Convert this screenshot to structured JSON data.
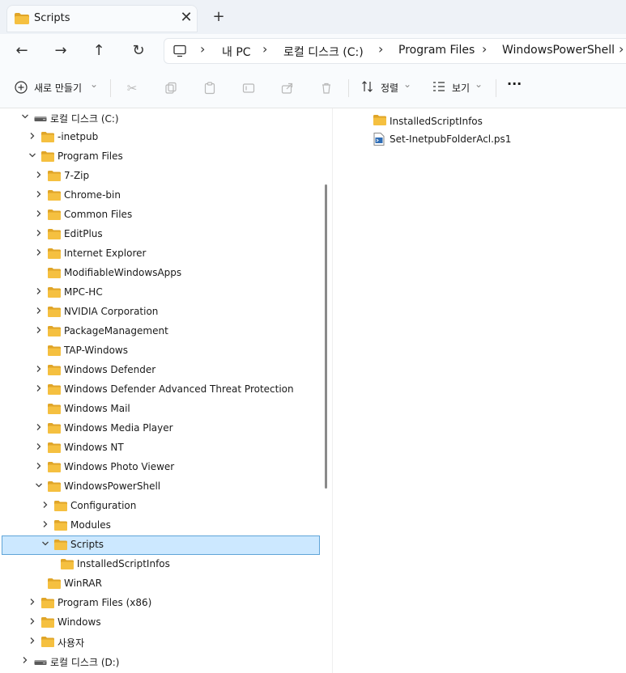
{
  "tab": {
    "title": "Scripts",
    "close": "✕",
    "new": "+"
  },
  "nav": {
    "back": "←",
    "forward": "→",
    "up": "↑",
    "refresh": "↻",
    "breadcrumb": [
      "내 PC",
      "로컬 디스크 (C:)",
      "Program Files",
      "WindowsPowerShell"
    ],
    "sep": "›"
  },
  "toolbar": {
    "new_label": "새로 만들기",
    "sort_label": "정렬",
    "view_label": "보기",
    "more": "···",
    "chevron": "⌄"
  },
  "tree": [
    {
      "label": "로컬 디스크 (C:)",
      "type": "drive",
      "chev": "down"
    },
    {
      "label": "-inetpub",
      "type": "folder",
      "chev": "right"
    },
    {
      "label": "Program Files",
      "type": "folder",
      "chev": "down"
    },
    {
      "label": "7-Zip",
      "type": "folder",
      "chev": "right"
    },
    {
      "label": "Chrome-bin",
      "type": "folder",
      "chev": "right"
    },
    {
      "label": "Common Files",
      "type": "folder",
      "chev": "right"
    },
    {
      "label": "EditPlus",
      "type": "folder",
      "chev": "right"
    },
    {
      "label": "Internet Explorer",
      "type": "folder",
      "chev": "right"
    },
    {
      "label": "ModifiableWindowsApps",
      "type": "folder",
      "chev": ""
    },
    {
      "label": "MPC-HC",
      "type": "folder",
      "chev": "right"
    },
    {
      "label": "NVIDIA Corporation",
      "type": "folder",
      "chev": "right"
    },
    {
      "label": "PackageManagement",
      "type": "folder",
      "chev": "right"
    },
    {
      "label": "TAP-Windows",
      "type": "folder",
      "chev": ""
    },
    {
      "label": "Windows Defender",
      "type": "folder",
      "chev": "right"
    },
    {
      "label": "Windows Defender Advanced Threat Protection",
      "type": "folder",
      "chev": "right"
    },
    {
      "label": "Windows Mail",
      "type": "folder",
      "chev": ""
    },
    {
      "label": "Windows Media Player",
      "type": "folder",
      "chev": "right"
    },
    {
      "label": "Windows NT",
      "type": "folder",
      "chev": "right"
    },
    {
      "label": "Windows Photo Viewer",
      "type": "folder",
      "chev": "right"
    },
    {
      "label": "WindowsPowerShell",
      "type": "folder",
      "chev": "down"
    },
    {
      "label": "Configuration",
      "type": "folder",
      "chev": "right"
    },
    {
      "label": "Modules",
      "type": "folder",
      "chev": "right"
    },
    {
      "label": "Scripts",
      "type": "folder",
      "chev": "down",
      "selected": true
    },
    {
      "label": "InstalledScriptInfos",
      "type": "folder",
      "chev": ""
    },
    {
      "label": "WinRAR",
      "type": "folder",
      "chev": ""
    },
    {
      "label": "Program Files (x86)",
      "type": "folder",
      "chev": "right"
    },
    {
      "label": "Windows",
      "type": "folder",
      "chev": "right"
    },
    {
      "label": "사용자",
      "type": "folder",
      "chev": "right"
    },
    {
      "label": "로컬 디스크 (D:)",
      "type": "drive",
      "chev": "right"
    }
  ],
  "files": [
    {
      "name": "InstalledScriptInfos",
      "type": "folder"
    },
    {
      "name": "Set-InetpubFolderAcl.ps1",
      "type": "ps1"
    }
  ],
  "colors": {
    "folder": "#f5c040",
    "folder_dark": "#e0a528",
    "selected_bg": "#cce8ff",
    "selected_border": "#5fa4d8"
  }
}
